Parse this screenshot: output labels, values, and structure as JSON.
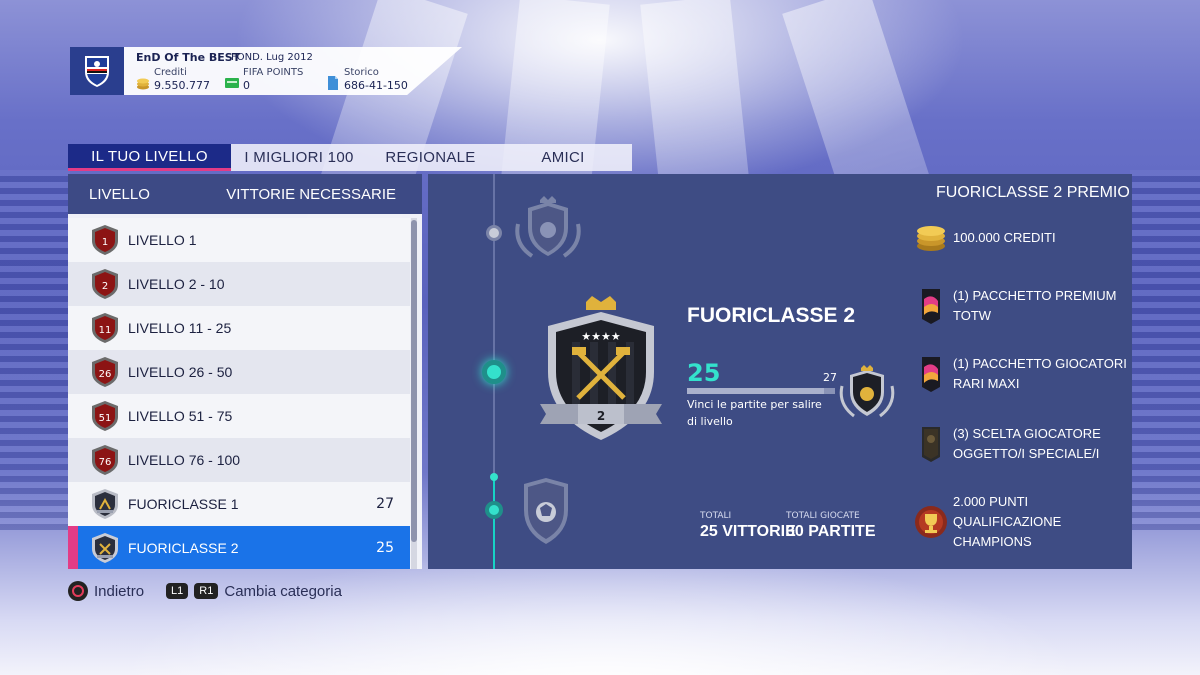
{
  "profile": {
    "club_name": "EnD Of The BEST",
    "founded": "FOND. Lug 2012",
    "credits_label": "Crediti",
    "credits_value": "9.550.777",
    "points_label": "FIFA POINTS",
    "points_value": "0",
    "history_label": "Storico",
    "history_value": "686-41-150"
  },
  "tabs": [
    {
      "label": "IL TUO LIVELLO",
      "active": true
    },
    {
      "label": "I MIGLIORI 100",
      "active": false
    },
    {
      "label": "REGIONALE",
      "active": false
    },
    {
      "label": "AMICI",
      "active": false
    }
  ],
  "levels": {
    "header_level": "LIVELLO",
    "header_wins": "VITTORIE NECESSARIE",
    "rows": [
      {
        "badge": "1",
        "label": "LIVELLO 1",
        "wins": ""
      },
      {
        "badge": "2",
        "label": "LIVELLO 2 - 10",
        "wins": ""
      },
      {
        "badge": "11",
        "label": "LIVELLO 11 - 25",
        "wins": ""
      },
      {
        "badge": "26",
        "label": "LIVELLO 26 - 50",
        "wins": ""
      },
      {
        "badge": "51",
        "label": "LIVELLO 51 - 75",
        "wins": ""
      },
      {
        "badge": "76",
        "label": "LIVELLO 76 - 100",
        "wins": ""
      },
      {
        "badge": "",
        "label": "FUORICLASSE 1",
        "wins": "27"
      },
      {
        "badge": "",
        "label": "FUORICLASSE 2",
        "wins": "25",
        "selected": true
      }
    ]
  },
  "detail": {
    "title": "FUORICLASSE 2",
    "badge_number": "2",
    "current_wins": "25",
    "required_wins": "27",
    "progress_fraction": 0.926,
    "hint": "Vinci le partite per salire di livello",
    "totals_label_1": "TOTALI",
    "totals_value_1": "25 VITTORIE",
    "totals_label_2": "TOTALI GIOCATE",
    "totals_value_2": "30 PARTITE"
  },
  "prizes": {
    "title": "FUORICLASSE 2 PREMIO",
    "items": [
      {
        "icon": "coins-icon",
        "label": "100.000 CREDITI"
      },
      {
        "icon": "premium-pack-icon",
        "label": "(1) PACCHETTO PREMIUM TOTW"
      },
      {
        "icon": "rare-pack-icon",
        "label": "(1) PACCHETTO GIOCATORI RARI MAXI"
      },
      {
        "icon": "player-pick-icon",
        "label": "(3) SCELTA GIOCATORE OGGETTO/I SPECIALE/I"
      },
      {
        "icon": "champions-points-icon",
        "label": "2.000 PUNTI QUALIFICAZIONE CHAMPIONS"
      }
    ]
  },
  "footer": {
    "back_label": "Indietro",
    "l1": "L1",
    "r1": "R1",
    "change_label": "Cambia categoria"
  },
  "colors": {
    "accent_teal": "#34e1cc",
    "selected_row": "#1a73e8",
    "marker_pink": "#e23c86",
    "tab_active": "#1c2a88"
  }
}
